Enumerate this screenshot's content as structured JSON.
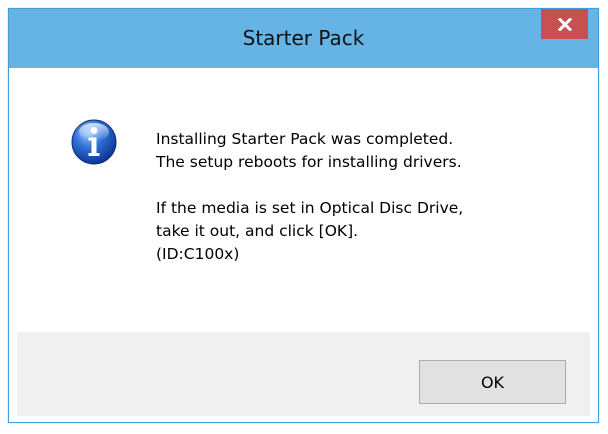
{
  "window": {
    "title": "Starter Pack",
    "accent_color": "#66b3e6",
    "close_button_color": "#c75050"
  },
  "icons": {
    "info": "info-icon",
    "close": "close-icon"
  },
  "message": {
    "line1": "Installing Starter Pack was completed.",
    "line2": "The setup reboots for installing drivers.",
    "line3": "If the media is set in Optical Disc Drive,",
    "line4": "take it out, and click [OK].",
    "line5": "(ID:C100x)"
  },
  "buttons": {
    "ok_label": "OK"
  }
}
